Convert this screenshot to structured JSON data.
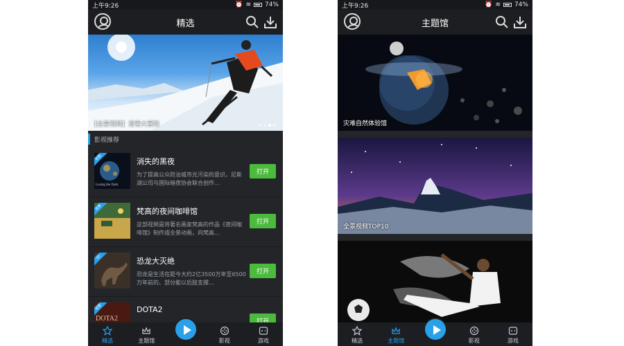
{
  "left_phone": {
    "status": {
      "time": "上午9:26",
      "battery": "74%"
    },
    "title": "精选",
    "banner": {
      "caption": "【全景视频】滑雪大冒险",
      "active_dot": 3,
      "dot_count": 4
    },
    "section_title": "影视推荐",
    "items": [
      {
        "title": "消失的黑夜",
        "desc": "为了提高公众防治城市光污染的意识，尼斯湖公司与国际暗夜协会联合创作...",
        "button": "打开",
        "tag": "全景",
        "thumb_text": "Losing the Dark"
      },
      {
        "title": "梵高的夜间咖啡馆",
        "desc": "这部视频是将著名画家梵高的作品《夜间咖啡馆》制作成全景动画，向梵高...",
        "button": "打开",
        "tag": "全景",
        "thumb_text": ""
      },
      {
        "title": "恐龙大灭绝",
        "desc": "恐龙是生活在距今大约2亿3500万年至6500万年前的、部分能以后肢支撑...",
        "button": "打开",
        "tag": "3D",
        "thumb_text": ""
      },
      {
        "title": "DOTA2",
        "desc": "",
        "button": "打开",
        "tag": "全景",
        "thumb_text": "DOTA2"
      }
    ],
    "nav": [
      {
        "label": "精选",
        "icon": "star-icon",
        "active": true
      },
      {
        "label": "主题馆",
        "icon": "crown-icon",
        "active": false
      },
      {
        "label": "影视",
        "icon": "film-icon",
        "active": false
      },
      {
        "label": "游戏",
        "icon": "gamepad-icon",
        "active": false
      }
    ]
  },
  "right_phone": {
    "status": {
      "time": "上午9:26",
      "battery": "74%"
    },
    "title": "主题馆",
    "cards": [
      {
        "caption": "灾难自然体验馆"
      },
      {
        "caption": "全景视频TOP10"
      },
      {
        "caption": ""
      }
    ],
    "nav": [
      {
        "label": "精选",
        "icon": "star-icon",
        "active": false
      },
      {
        "label": "主题馆",
        "icon": "crown-icon",
        "active": true
      },
      {
        "label": "影视",
        "icon": "film-icon",
        "active": false
      },
      {
        "label": "游戏",
        "icon": "gamepad-icon",
        "active": false
      }
    ]
  },
  "colors": {
    "accent": "#29a0e8",
    "open_button": "#4cba3c",
    "background": "#232529"
  }
}
